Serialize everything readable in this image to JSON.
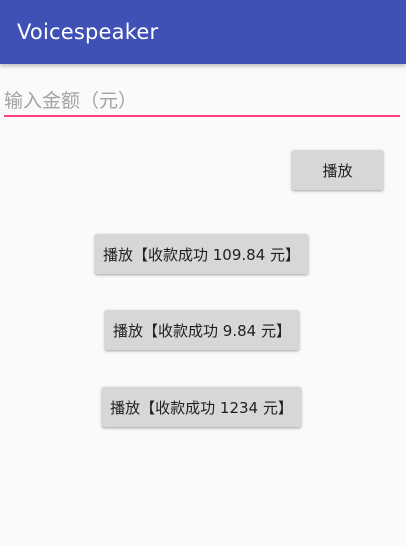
{
  "app_bar": {
    "title": "Voicespeaker",
    "color": "#3f51b5"
  },
  "amount_input": {
    "placeholder": "输入金额（元）",
    "value": "",
    "underline_color": "#ff4081"
  },
  "buttons": {
    "play": "播放",
    "preset_1": "播放【收款成功 109.84 元】",
    "preset_2": "播放【收款成功 9.84 元】",
    "preset_3": "播放【收款成功 1234 元】"
  }
}
